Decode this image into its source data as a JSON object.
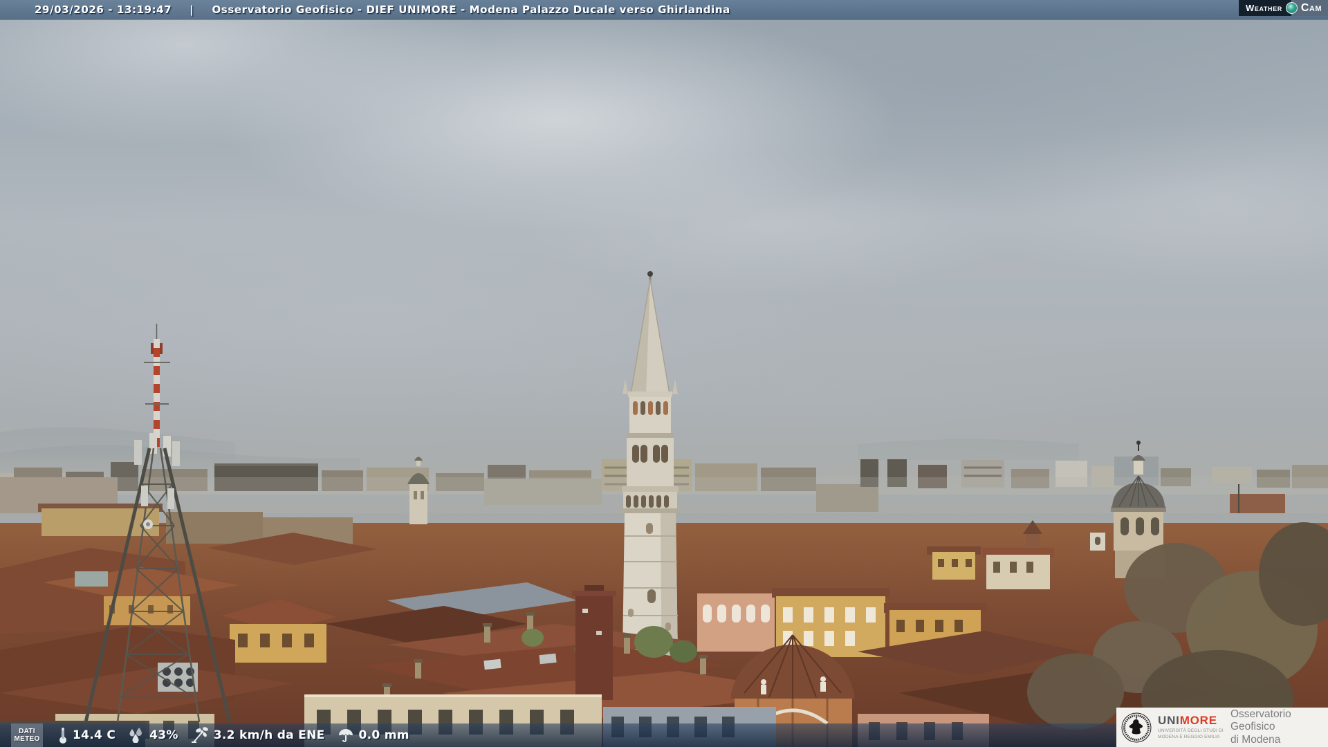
{
  "header": {
    "datetime": "29/03/2026 - 13:19:47",
    "separator": "|",
    "title": "Osservatorio Geofisico - DIEF UNIMORE - Modena Palazzo Ducale verso Ghirlandina"
  },
  "watermark": {
    "brand_left": "Weather",
    "brand_right": "Cam"
  },
  "weather_bar": {
    "label_line1": "DATI",
    "label_line2": "METEO",
    "readings": [
      {
        "icon": "thermometer-icon",
        "value": "14.4 C"
      },
      {
        "icon": "humidity-icon",
        "value": "43%"
      },
      {
        "icon": "wind-icon",
        "value": "3.2 km/h da ENE"
      },
      {
        "icon": "rain-icon",
        "value": "0.0 mm"
      }
    ]
  },
  "footer_logo": {
    "acronym_gray": "UNI",
    "acronym_red": "MORE",
    "subtitle_line1": "UNIVERSITÀ DEGLI STUDI DI",
    "subtitle_line2": "MODENA E REGGIO EMILIA",
    "org_line1": "Osservatorio Geofisico",
    "org_line2": "di Modena"
  },
  "colors": {
    "header_bar": "#5e7a97",
    "overlay_navy": "#1f3b5a",
    "weathercam_teal": "#2ea391",
    "weathercam_dark": "#141f2c",
    "weathercam_gray": "#5a6a7c",
    "unimore_red": "#dc3a22",
    "unimore_gray": "#55585c"
  }
}
